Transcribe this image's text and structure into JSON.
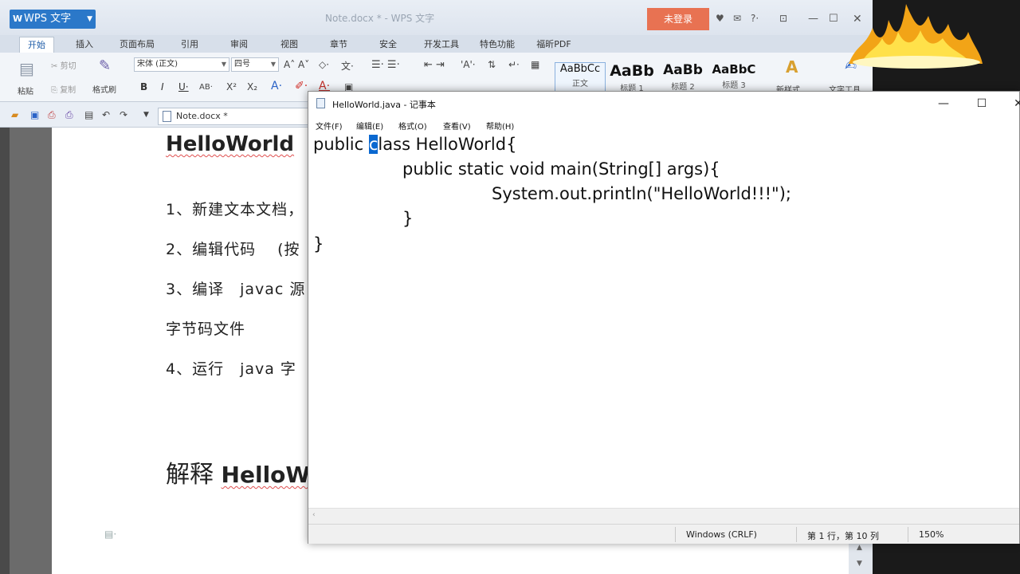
{
  "wps": {
    "app_button": "WPS 文字",
    "doc_title": "Note.docx * - WPS 文字",
    "login_button": "未登录",
    "tabs": [
      "开始",
      "插入",
      "页面布局",
      "引用",
      "审阅",
      "视图",
      "章节",
      "安全",
      "开发工具",
      "特色功能",
      "福昕PDF"
    ],
    "ribbon": {
      "paste": "粘贴",
      "cut": "剪切",
      "copy": "复制",
      "format_painter": "格式刷",
      "font_name": "宋体 (正文)",
      "font_size": "四号",
      "styles": [
        {
          "preview": "AaBbCc",
          "label": "正文"
        },
        {
          "preview": "AaBb",
          "label": "标题 1"
        },
        {
          "preview": "AaBb",
          "label": "标题 2"
        },
        {
          "preview": "AaBbC",
          "label": "标题 3"
        }
      ],
      "new_style": "新样式",
      "text_tools": "文字工具"
    },
    "doc_tab": "Note.docx *",
    "document": {
      "heading": "HelloWorld",
      "lines": [
        "1、新建文本文档，",
        "2、编辑代码　 (按",
        "3、编译　javac 源",
        "字节码文件",
        "4、运行　java 字"
      ],
      "heading2_cn": "解释",
      "heading2_en": "HelloW"
    }
  },
  "notepad": {
    "title": "HelloWorld.java - 记事本",
    "menu": [
      "文件(F)",
      "编辑(E)",
      "格式(O)",
      "查看(V)",
      "帮助(H)"
    ],
    "code": {
      "l1_a": "public ",
      "l1_sel": "c",
      "l1_b": "lass HelloWorld{",
      "l2": "public static void main(String[] args){",
      "l3": "System.out.println(\"HelloWorld!!!\");",
      "l4": "}",
      "l5": "}"
    },
    "status": {
      "encoding": "Windows (CRLF)",
      "position": "第 1 行，第 10 列",
      "zoom": "150%"
    }
  }
}
